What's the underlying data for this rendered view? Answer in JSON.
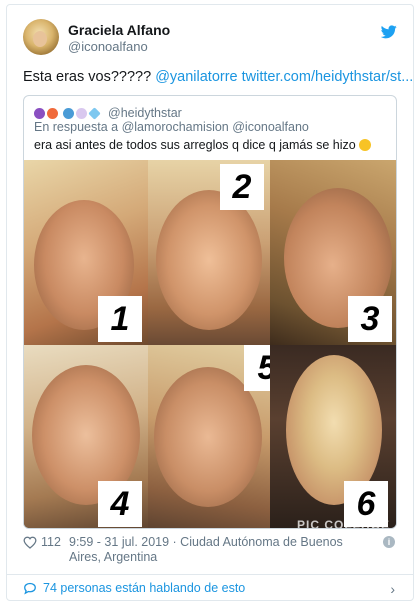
{
  "author": {
    "name": "Graciela Alfano",
    "handle": "@iconoalfano"
  },
  "tweet": {
    "text_plain": "Esta eras vos?????",
    "mention": "@yanilatorre",
    "link": "twitter.com/heidythstar/st..."
  },
  "quoted": {
    "handle": "@heidythstar",
    "reply_prefix": "En respuesta a",
    "reply_to": "@lamorochamision @iconoalfano",
    "text": "era asi antes de todos sus arreglos q dice q jamás se hizo"
  },
  "collage": {
    "numbers": [
      "1",
      "2",
      "3",
      "4",
      "5",
      "6"
    ],
    "watermark": "PIC COLLAGE"
  },
  "meta": {
    "likes": "112",
    "timestamp": "9:59 - 31 jul. 2019 · Ciudad Autónoma de Buenos Aires, Argentina",
    "info_glyph": "i"
  },
  "footer": {
    "discussion": "74 personas están hablando de esto"
  },
  "colors": {
    "link": "#1b95e0",
    "secondary_text": "#657786",
    "border": "#e1e8ed"
  },
  "icons": {
    "bird": "twitter-bird-icon",
    "heart": "heart-icon",
    "bubble": "speech-bubble-icon",
    "chevron": "chevron-right-icon",
    "info": "info-icon"
  }
}
